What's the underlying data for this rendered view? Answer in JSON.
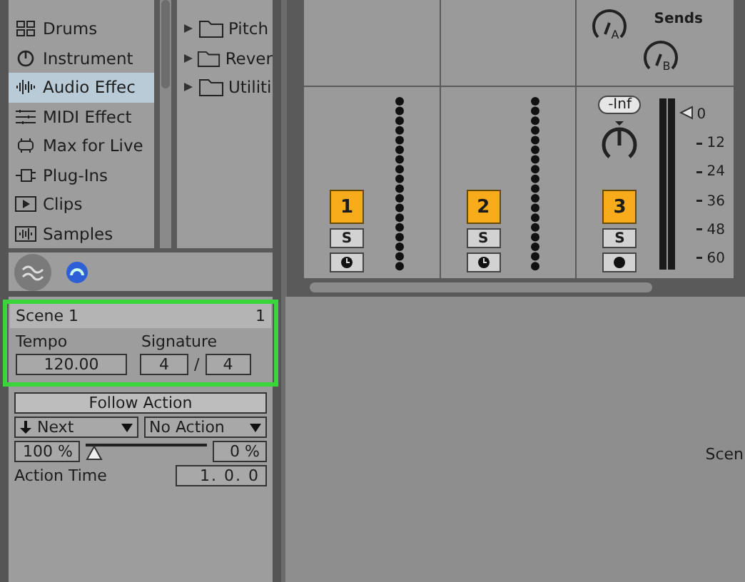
{
  "browser": {
    "categories": [
      {
        "label": "Drums",
        "kind": "drums",
        "selected": false
      },
      {
        "label": "Instrument",
        "kind": "instruments",
        "selected": false
      },
      {
        "label": "Audio Effec",
        "kind": "audio",
        "selected": true
      },
      {
        "label": "MIDI Effect",
        "kind": "midi",
        "selected": false
      },
      {
        "label": "Max for Live",
        "kind": "max",
        "selected": false
      },
      {
        "label": "Plug-Ins",
        "kind": "plugins",
        "selected": false
      },
      {
        "label": "Clips",
        "kind": "clips",
        "selected": false
      },
      {
        "label": "Samples",
        "kind": "samples",
        "selected": false
      }
    ],
    "folders": [
      "Pitch",
      "Rever",
      "Utiliti"
    ]
  },
  "mixer": {
    "tracks": [
      {
        "kind": "dots",
        "number": "1",
        "solo": "S"
      },
      {
        "kind": "dots",
        "number": "2",
        "solo": "S"
      },
      {
        "kind": "volume",
        "number": "3",
        "solo": "S",
        "sends_label": "Sends",
        "sends": [
          "A",
          "B"
        ],
        "volume": "-Inf",
        "scale": [
          "0",
          "12",
          "24",
          "36",
          "48",
          "60"
        ]
      }
    ]
  },
  "scene": {
    "highlighted": true,
    "title": "Scene 1",
    "number": "1",
    "tempo_label": "Tempo",
    "tempo": "120.00",
    "signature_label": "Signature",
    "sig_num": "4",
    "sig_sep": "/",
    "sig_den": "4",
    "follow_action": "Follow Action",
    "action_a": "Next",
    "action_b": "No Action",
    "chance_a": "100 %",
    "chance_slider": {
      "level": 0
    },
    "chance_b": "0 %",
    "action_time_label": "Action Time",
    "action_time": "1. 0. 0"
  },
  "session": {
    "scene_label": "Scen"
  }
}
